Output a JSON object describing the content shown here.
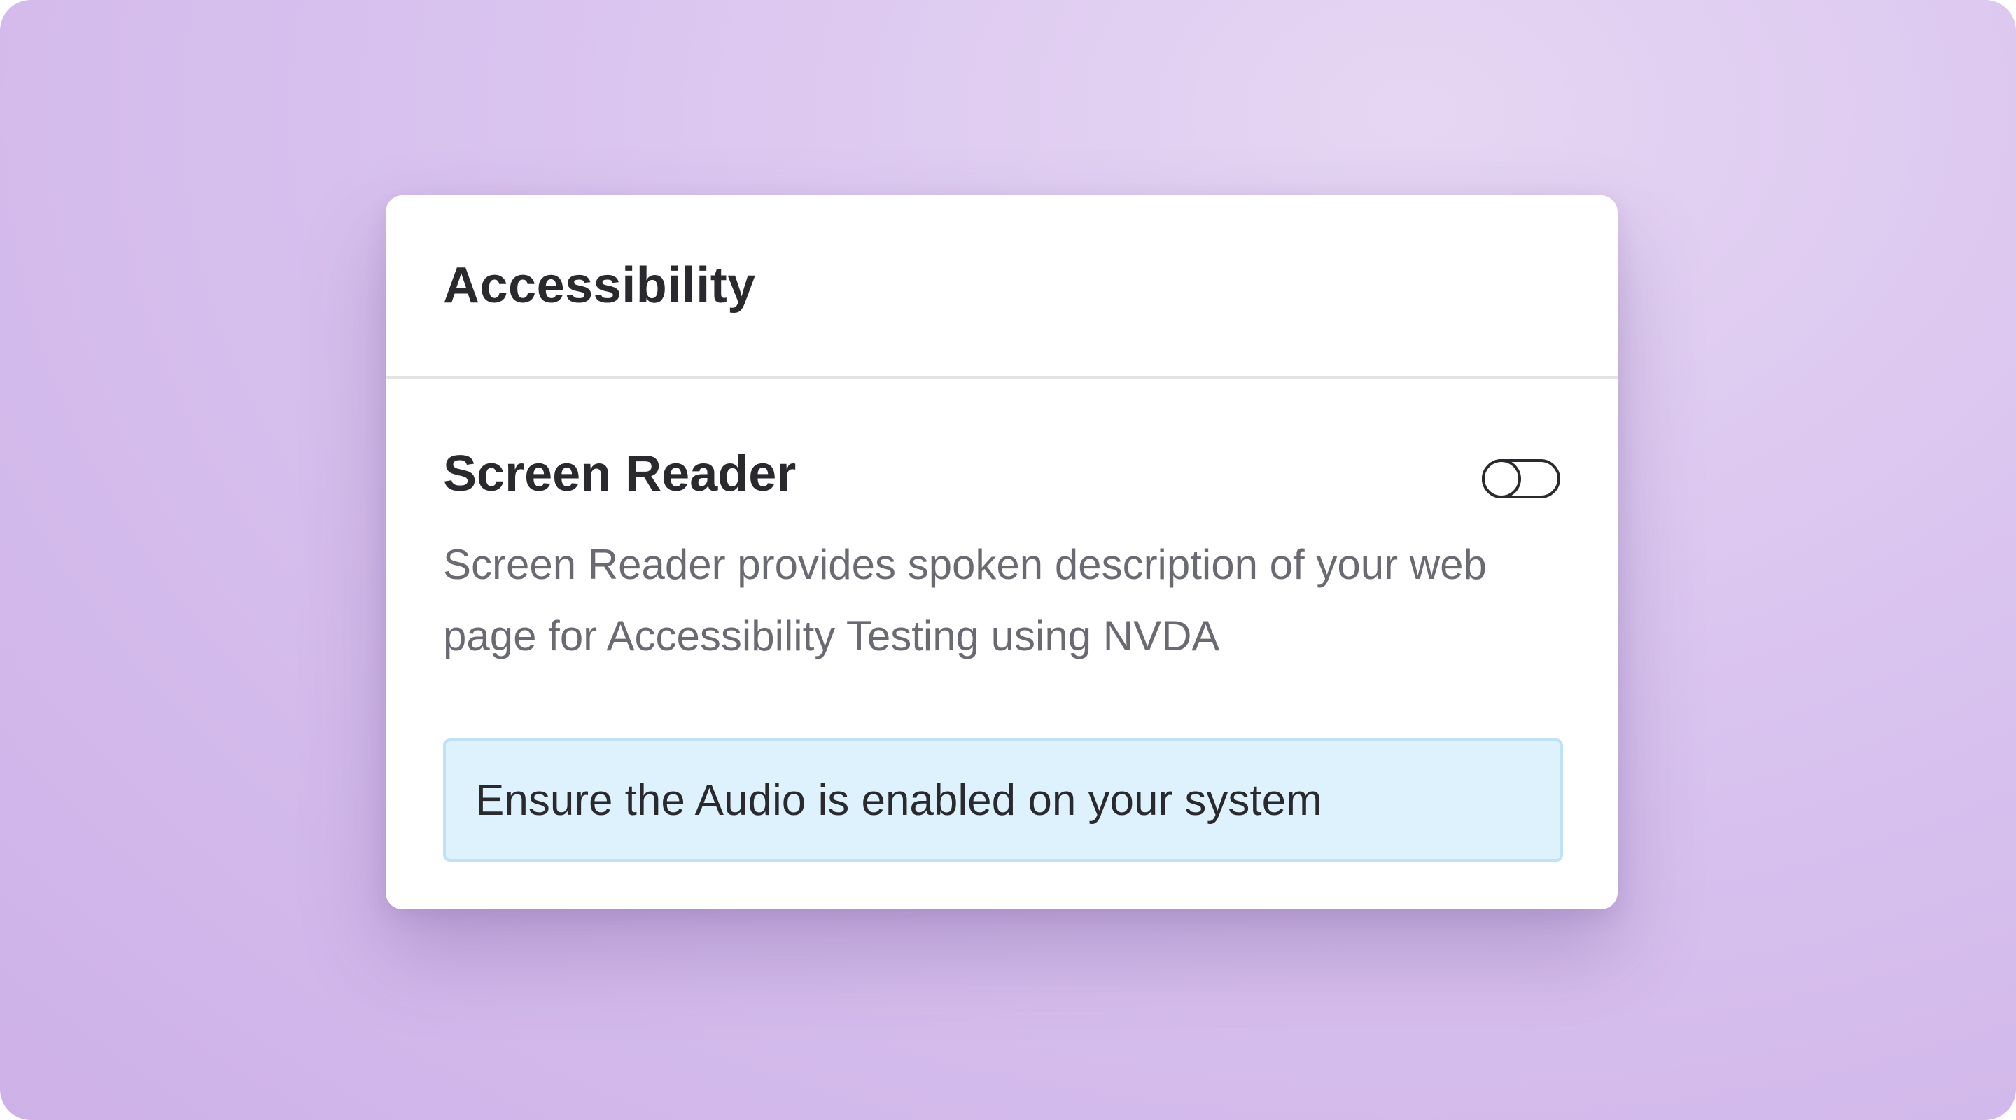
{
  "panel": {
    "title": "Accessibility"
  },
  "screen_reader": {
    "title": "Screen Reader",
    "description": "Screen Reader provides spoken description of your web page for Accessibility Testing using NVDA",
    "toggle_state": "off"
  },
  "notice": {
    "text": "Ensure the Audio is enabled on your system"
  },
  "colors": {
    "background": "#d9c3ef",
    "card": "#ffffff",
    "notice_background": "#def2fd",
    "notice_border": "#bfe2f6",
    "title_text": "#2a2a2e",
    "description_text": "#6a6a72"
  }
}
